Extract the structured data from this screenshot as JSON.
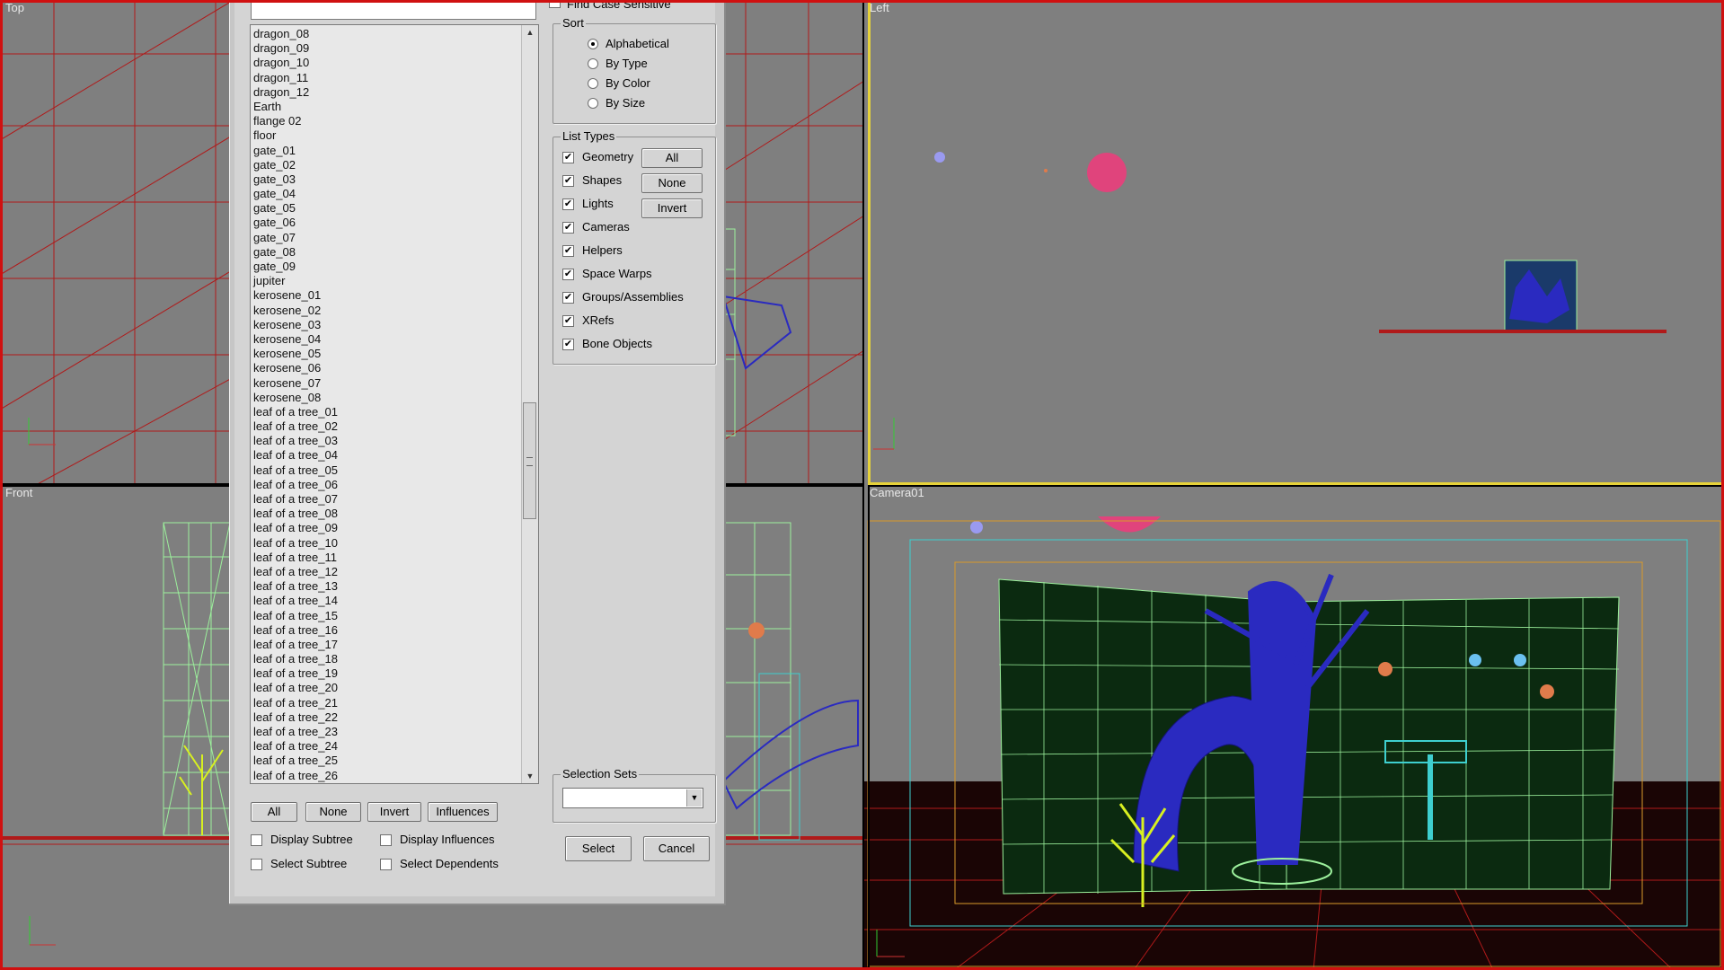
{
  "viewports": {
    "top": {
      "label": "Top"
    },
    "front": {
      "label": "Front"
    },
    "left": {
      "label": "Left"
    },
    "camera": {
      "label": "Camera01"
    }
  },
  "dialog": {
    "find_case_sensitive": {
      "label": "Find Case Sensitive",
      "checked": false
    },
    "object_list": [
      "dragon_08",
      "dragon_09",
      "dragon_10",
      "dragon_11",
      "dragon_12",
      "Earth",
      "flange 02",
      "floor",
      "gate_01",
      "gate_02",
      "gate_03",
      "gate_04",
      "gate_05",
      "gate_06",
      "gate_07",
      "gate_08",
      "gate_09",
      "jupiter",
      "kerosene_01",
      "kerosene_02",
      "kerosene_03",
      "kerosene_04",
      "kerosene_05",
      "kerosene_06",
      "kerosene_07",
      "kerosene_08",
      "leaf of a tree_01",
      "leaf of a tree_02",
      "leaf of a tree_03",
      "leaf of a tree_04",
      "leaf of a tree_05",
      "leaf of a tree_06",
      "leaf of a tree_07",
      "leaf of a tree_08",
      "leaf of a tree_09",
      "leaf of a tree_10",
      "leaf of a tree_11",
      "leaf of a tree_12",
      "leaf of a tree_13",
      "leaf of a tree_14",
      "leaf of a tree_15",
      "leaf of a tree_16",
      "leaf of a tree_17",
      "leaf of a tree_18",
      "leaf of a tree_19",
      "leaf of a tree_20",
      "leaf of a tree_21",
      "leaf of a tree_22",
      "leaf of a tree_23",
      "leaf of a tree_24",
      "leaf of a tree_25",
      "leaf of a tree_26"
    ],
    "list_buttons": {
      "all": "All",
      "none": "None",
      "invert": "Invert",
      "influences": "Influences"
    },
    "options": {
      "display_subtree": "Display Subtree",
      "display_influences": "Display Influences",
      "select_subtree": "Select Subtree",
      "select_dependents": "Select Dependents"
    },
    "sort": {
      "title": "Sort",
      "options": [
        "Alphabetical",
        "By Type",
        "By Color",
        "By Size"
      ],
      "selected": "Alphabetical"
    },
    "list_types": {
      "title": "List Types",
      "items": [
        "Geometry",
        "Shapes",
        "Lights",
        "Cameras",
        "Helpers",
        "Space Warps",
        "Groups/Assemblies",
        "XRefs",
        "Bone Objects"
      ],
      "buttons": {
        "all": "All",
        "none": "None",
        "invert": "Invert"
      }
    },
    "selection_sets": {
      "title": "Selection Sets",
      "value": ""
    },
    "select_label": "Select",
    "cancel_label": "Cancel"
  },
  "colors": {
    "frame": "#d01010",
    "active_viewport": "#e6d23a",
    "grid_red": "#b01a1a",
    "wire_green": "#9cf09c",
    "wire_blue": "#2a2ac0",
    "safe_frame_cyan": "#3ecfcf",
    "safe_frame_orange": "#d99a2a"
  }
}
